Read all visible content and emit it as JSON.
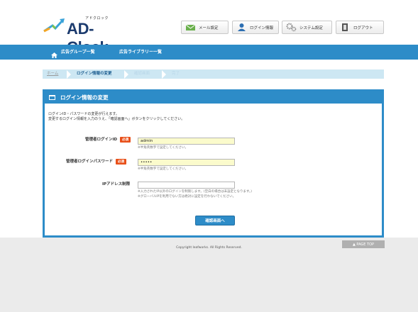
{
  "header": {
    "logo_kana": "アドクロック",
    "logo_text": "AD-Clock",
    "buttons": [
      {
        "label": "メール設定",
        "icon": "mail-icon"
      },
      {
        "label": "ログイン情報",
        "icon": "user-icon"
      },
      {
        "label": "システム設定",
        "icon": "gear-icon"
      },
      {
        "label": "ログアウト",
        "icon": "logout-icon"
      }
    ]
  },
  "nav": {
    "items": [
      {
        "label": "広告グループ一覧",
        "icon": "home-icon"
      },
      {
        "label": "広告ライブラリー一覧"
      }
    ]
  },
  "breadcrumb": {
    "steps": [
      "ホーム",
      "ログイン情報の変更",
      "確認画面",
      "完了"
    ]
  },
  "panel": {
    "title": "ログイン情報の変更",
    "intro_line1": "ログインID・パスワードの変更が行えます。",
    "intro_line2": "変更するログイン情報を入力のうえ、「確認画面へ」ボタンをクリックしてください。",
    "required_badge": "必須",
    "fields": {
      "login_id": {
        "label": "管理者ログインID",
        "value": "admin",
        "hint": "※半角英数字で設定してください。"
      },
      "password": {
        "label": "管理者ログインパスワード",
        "value": "•••••",
        "hint": "※半角英数字で設定してください。"
      },
      "ip": {
        "label": "IPアドレス制限",
        "value": "",
        "hint1": "※入力されたIP以外のログインを制限します。(空白の場合は未設定となります。)",
        "hint2": "※グローバルIPを利用でない方は絶対に設定を行わないでください。"
      }
    },
    "confirm_button": "確認画面へ"
  },
  "footer": {
    "copyright": "Copyright leafworks. All Rights Reserved.",
    "page_top": "▲ PAGE TOP"
  },
  "colors": {
    "brand_blue": "#2d8cc8",
    "logo_navy": "#1c3b6e",
    "required_orange": "#e8501a",
    "input_yellow": "#fbfbcc"
  }
}
